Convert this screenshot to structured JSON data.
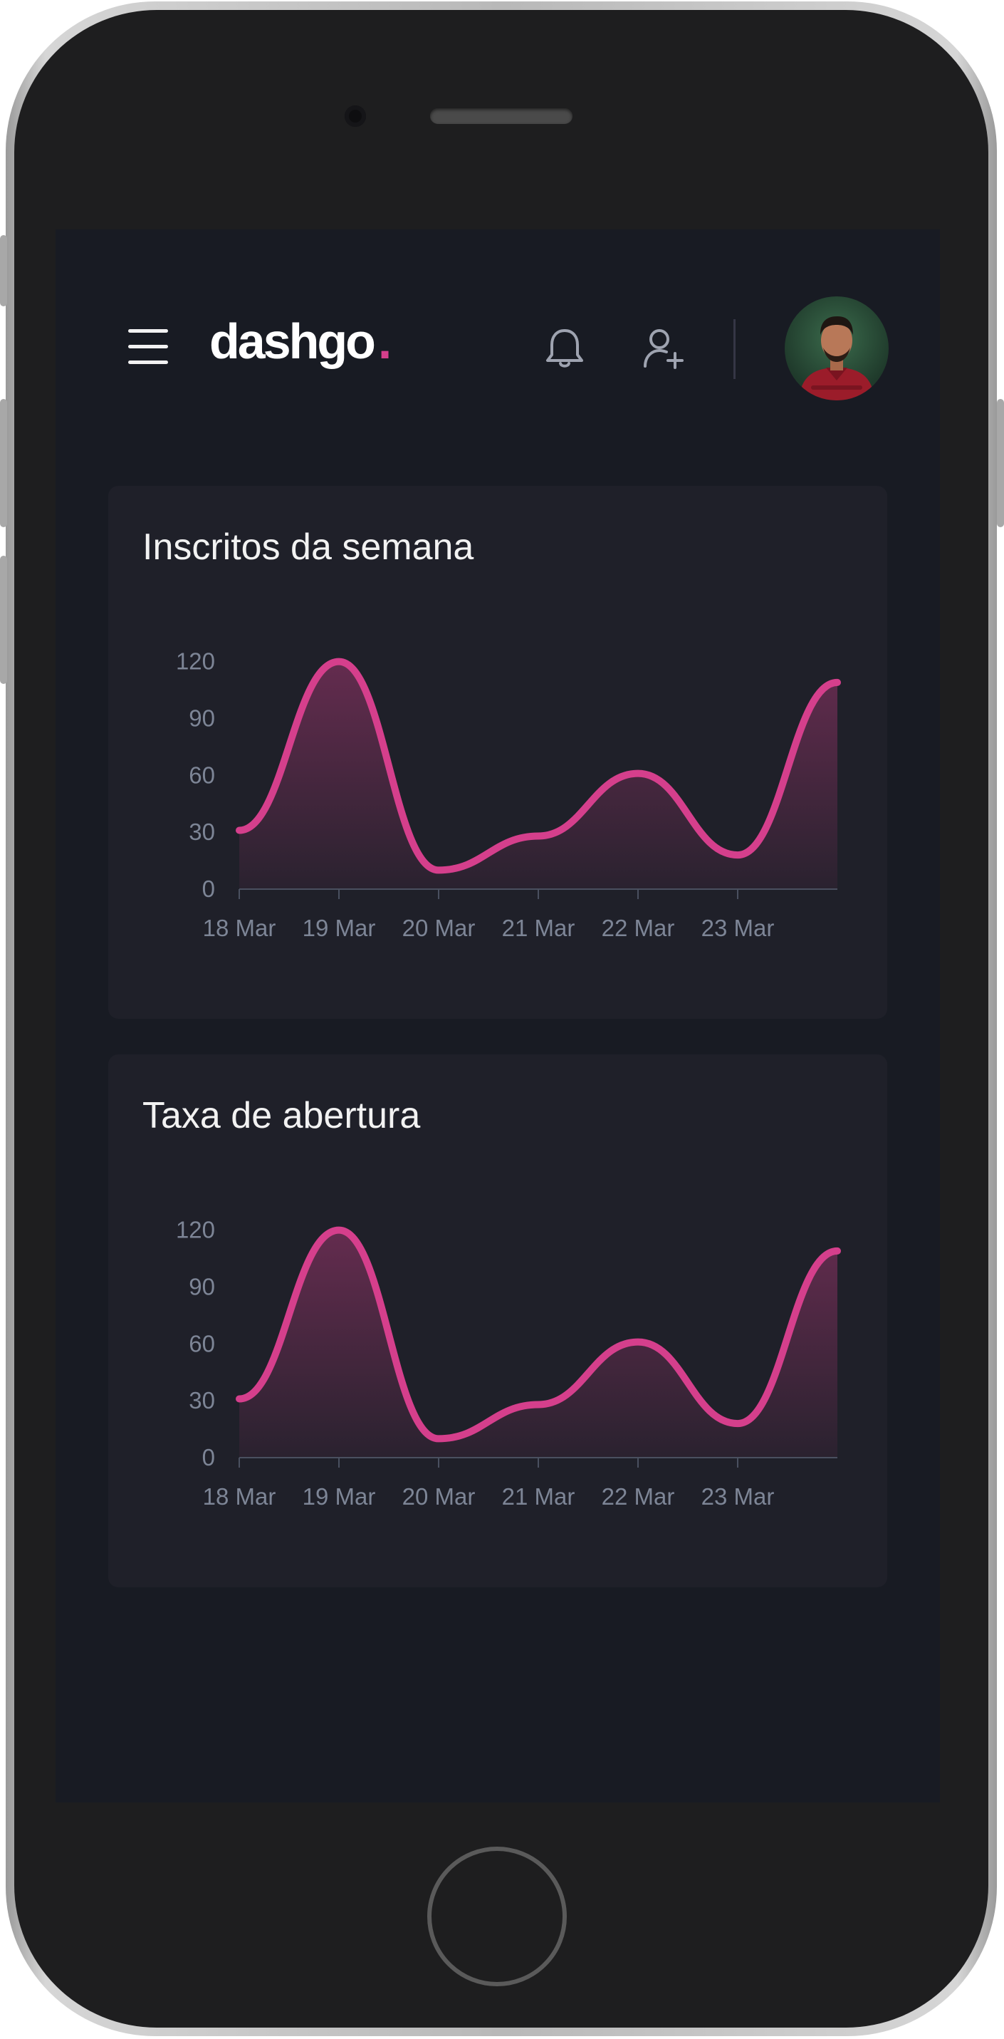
{
  "header": {
    "logo_text": "dashgo",
    "logo_dot": ".",
    "accent_color": "#d53f8c",
    "icons": [
      "menu-icon",
      "bell-icon",
      "add-user-icon"
    ]
  },
  "charts": [
    {
      "title": "Inscritos da semana"
    },
    {
      "title": "Taxa de abertura"
    }
  ],
  "chart_data": [
    {
      "type": "area",
      "title": "Inscritos da semana",
      "x_tick_labels": [
        "18 Mar",
        "19 Mar",
        "20 Mar",
        "21 Mar",
        "22 Mar",
        "23 Mar"
      ],
      "y_ticks": [
        "0",
        "30",
        "60",
        "90",
        "120"
      ],
      "ylim": [
        0,
        130
      ],
      "x": [
        0,
        1,
        2,
        3,
        4,
        5,
        6
      ],
      "values": [
        31,
        120,
        10,
        28,
        61,
        18,
        109
      ],
      "grid": false,
      "line_color": "#d53f8c"
    },
    {
      "type": "area",
      "title": "Taxa de abertura",
      "x_tick_labels": [
        "18 Mar",
        "19 Mar",
        "20 Mar",
        "21 Mar",
        "22 Mar",
        "23 Mar"
      ],
      "y_ticks": [
        "0",
        "30",
        "60",
        "90",
        "120"
      ],
      "ylim": [
        0,
        130
      ],
      "x": [
        0,
        1,
        2,
        3,
        4,
        5,
        6
      ],
      "values": [
        31,
        120,
        10,
        28,
        61,
        18,
        109
      ],
      "grid": false,
      "line_color": "#d53f8c"
    }
  ]
}
